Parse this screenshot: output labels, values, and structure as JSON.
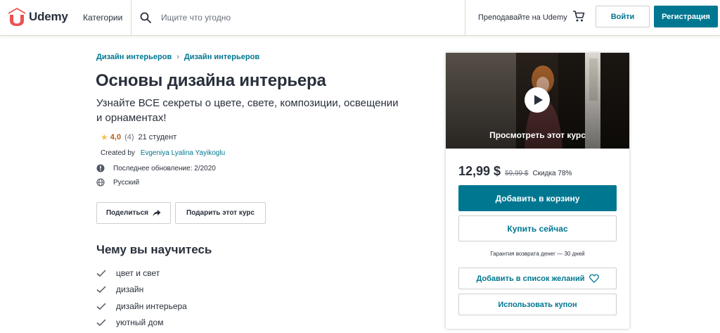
{
  "header": {
    "brand": "Udemy",
    "categories_label": "Категории",
    "search_placeholder": "Ищите что угодно",
    "teach_label": "Преподавайте на Udemy",
    "login_label": "Войти",
    "signup_label": "Регистрация"
  },
  "course": {
    "breadcrumb": [
      "Дизайн интерьеров",
      "Дизайн интерьеров"
    ],
    "title": "Основы дизайна интерьера",
    "subtitle": "Узнайте ВСЕ секреты о цвете, свете, композиции, освещении и орнаментах!",
    "rating": "4,0",
    "rating_count": "(4)",
    "students": "21 студент",
    "created_by_label": "Created by",
    "author": "Evgeniya Lyalina Yayikoglu",
    "last_updated": "Последнее обновление: 2/2020",
    "language": "Русский",
    "share_label": "Поделиться",
    "gift_label": "Подарить этот курс"
  },
  "learn": {
    "title": "Чему вы научитесь",
    "items": [
      "цвет и свет",
      "дизайн",
      "дизайн интерьера",
      "уютный дом"
    ]
  },
  "card": {
    "preview_label": "Просмотреть этот курс",
    "price": "12,99 $",
    "old_price": "59,99 $",
    "discount": "Скидка 78%",
    "add_to_cart_label": "Добавить в корзину",
    "buy_now_label": "Купить сейчас",
    "guarantee": "Гарантия возврата денег — 30 дней",
    "wishlist_label": "Добавить в список желаний",
    "coupon_label": "Использовать купон"
  },
  "icons": {
    "logo": "udemy-logo-icon",
    "search": "search-icon",
    "cart": "cart-icon",
    "star": "star-icon",
    "update": "alert-circle-icon",
    "language": "globe-icon",
    "share": "share-arrow-icon",
    "check": "check-icon",
    "play": "play-icon",
    "heart": "heart-icon"
  },
  "colors": {
    "brand_red": "#ec5252",
    "accent": "#007791",
    "rating_orange": "#be5a0e",
    "star": "#f4c150"
  }
}
